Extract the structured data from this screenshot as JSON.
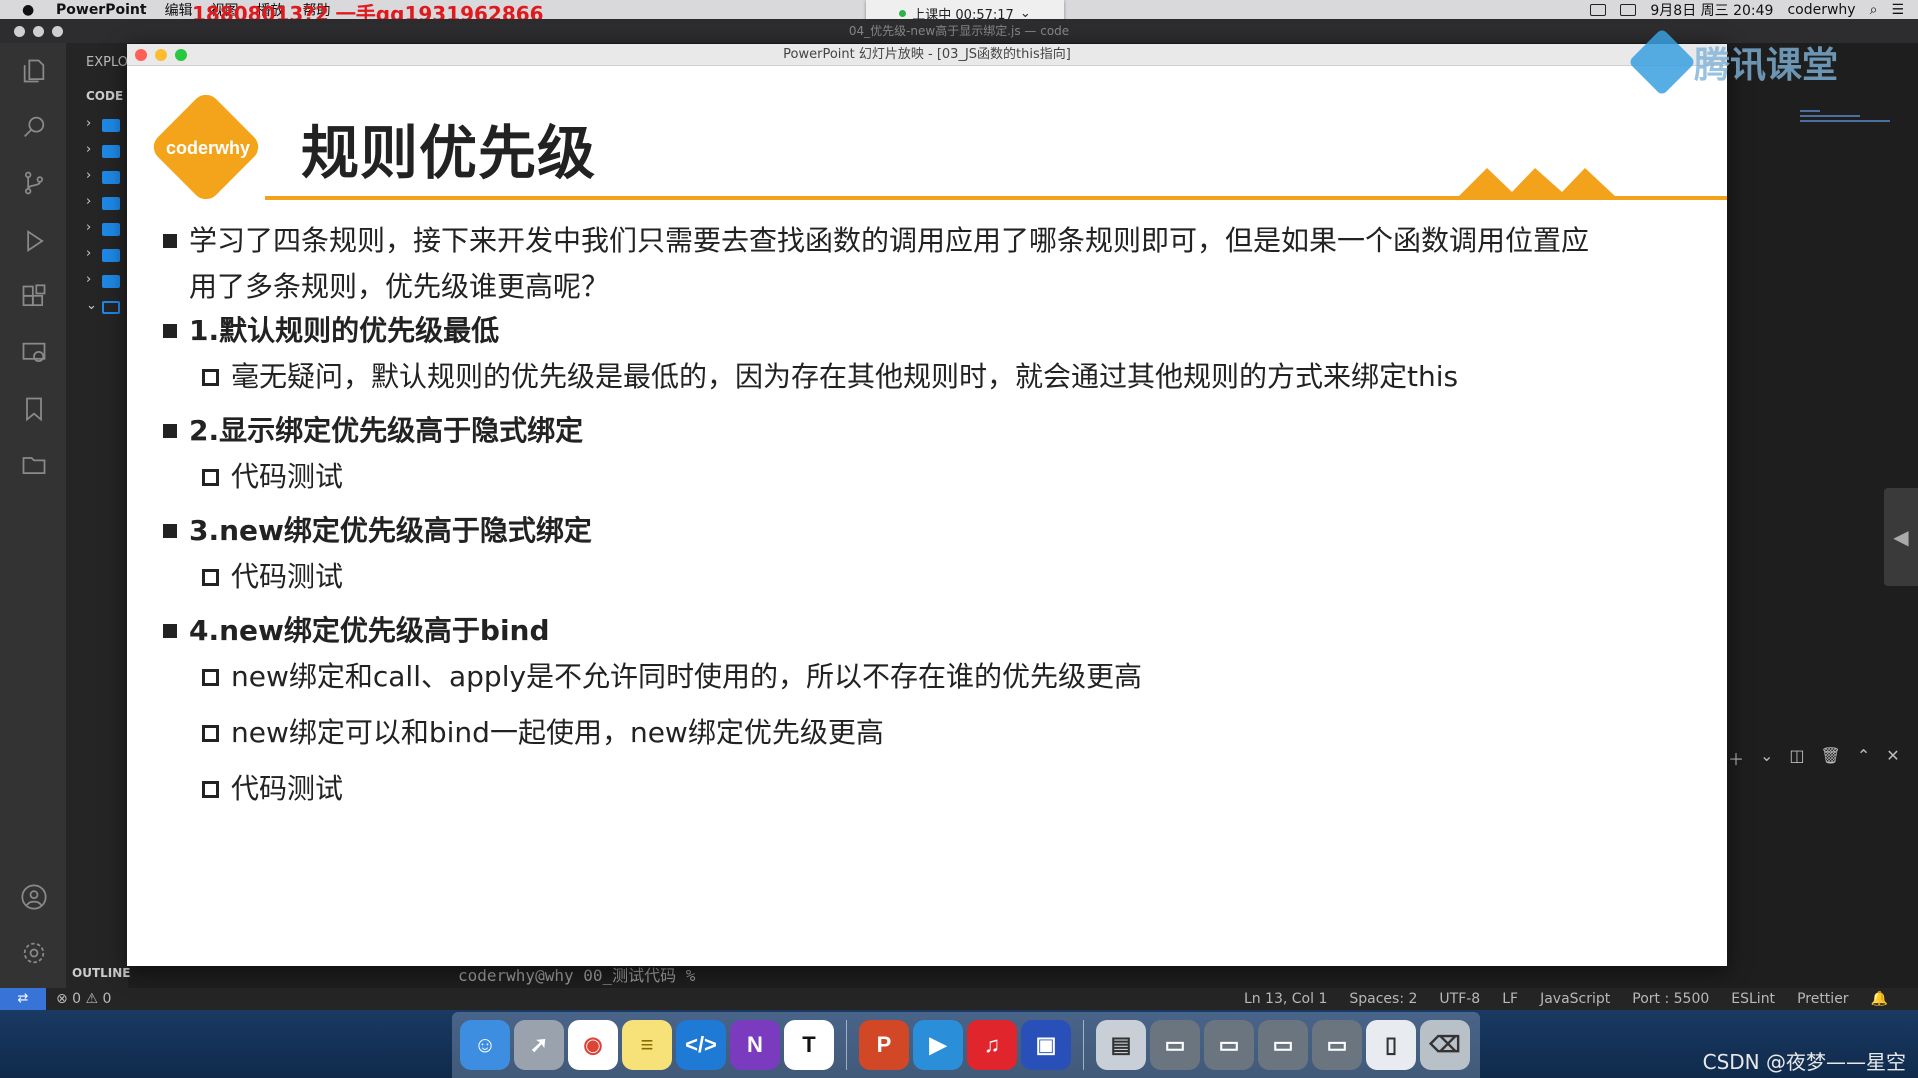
{
  "menubar": {
    "app_name": "PowerPoint",
    "menus": [
      "编辑",
      "视图",
      "播放",
      "帮助"
    ],
    "overlay_text": "18808013?2 一手qq1931962866",
    "clock": "9月8日 周三 20:49",
    "user": "coderwhy"
  },
  "live_badge": {
    "text": "上课中 00:57:17"
  },
  "vscode": {
    "window_title": "04_优先级-new高于显示绑定.js — code",
    "explorer_label": "EXPLO",
    "section_label": "CODE",
    "outline_label": "OUTLINE",
    "terminal_prompt": "coderwhy@why 00_测试代码 % ",
    "status": {
      "problems": "⊗ 0 ⚠ 0",
      "ln_col": "Ln 13, Col 1",
      "spaces": "Spaces: 2",
      "encoding": "UTF-8",
      "eol": "LF",
      "language": "JavaScript",
      "port": "Port : 5500",
      "eslint": "ESLint",
      "prettier": "Prettier"
    }
  },
  "ppt": {
    "window_title": "PowerPoint 幻灯片放映 - [03_JS函数的this指向]",
    "logo_text": "coderwhy",
    "slide_title": "规则优先级",
    "bullets": [
      {
        "text": "学习了四条规则，接下来开发中我们只需要去查找函数的调用应用了哪条规则即可，但是如果一个函数调用位置应用了多条规则，优先级谁更高呢？"
      },
      {
        "text": "1.默认规则的优先级最低"
      },
      {
        "text": "毫无疑问，默认规则的优先级是最低的，因为存在其他规则时，就会通过其他规则的方式来绑定this"
      },
      {
        "text": "2.显示绑定优先级高于隐式绑定"
      },
      {
        "text": "代码测试"
      },
      {
        "text": "3.new绑定优先级高于隐式绑定"
      },
      {
        "text": "代码测试"
      },
      {
        "text": "4.new绑定优先级高于bind"
      },
      {
        "text": "new绑定和call、apply是不允许同时使用的，所以不存在谁的优先级更高"
      },
      {
        "text": "new绑定可以和bind一起使用，new绑定优先级更高"
      },
      {
        "text": "代码测试"
      }
    ]
  },
  "overlay": {
    "tencent_logo_text": "腾讯课堂",
    "csdn_watermark": "CSDN @夜梦——星空"
  },
  "colors": {
    "accent_orange": "#f2a31b",
    "vscode_blue": "#3874d8",
    "overlay_red": "#e0191c"
  },
  "dock_icons": [
    "finder-icon",
    "launchpad-icon",
    "chrome-icon",
    "notes-icon",
    "vscode-icon",
    "onenote-icon",
    "typora-icon",
    "powerpoint-icon",
    "tencent-classroom-icon",
    "netease-music-icon",
    "screen-recorder-icon",
    "preview-icon",
    "window-thumbnail-icon",
    "window-thumbnail-icon",
    "window-thumbnail-icon",
    "window-thumbnail-icon",
    "document-icon",
    "trash-icon"
  ]
}
